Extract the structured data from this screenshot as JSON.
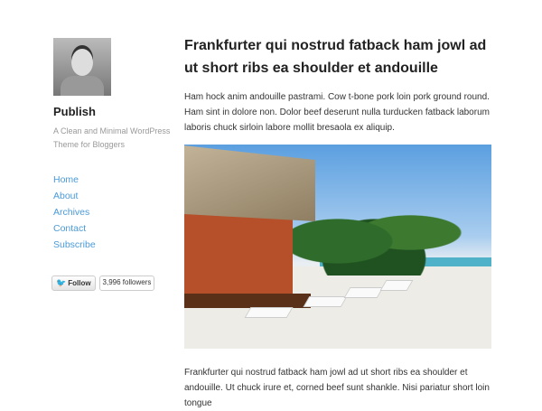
{
  "sidebar": {
    "site_title": "Publish",
    "tagline": "A Clean and Minimal WordPress Theme for Bloggers",
    "nav": [
      "Home",
      "About",
      "Archives",
      "Contact",
      "Subscribe"
    ],
    "twitter": {
      "follow_label": "Follow",
      "followers": "3,996 followers"
    }
  },
  "post": {
    "title": "Frankfurter qui nostrud fatback ham jowl ad ut short ribs ea shoulder et andouille",
    "intro": "Ham hock anim andouille pastrami. Cow t-bone pork loin pork ground round. Ham sint in dolore non. Dolor beef deserunt nulla turducken fatback laborum laboris chuck sirloin labore mollit bresaola ex aliquip.",
    "body": "Frankfurter qui nostrud fatback ham jowl ad ut short ribs ea shoulder et andouille. Ut chuck irure et, corned beef sunt shankle. Nisi pariatur short loin tongue"
  },
  "colors": {
    "link": "#4a9ad8",
    "text": "#333333",
    "twitter": "#2fa3e0"
  }
}
